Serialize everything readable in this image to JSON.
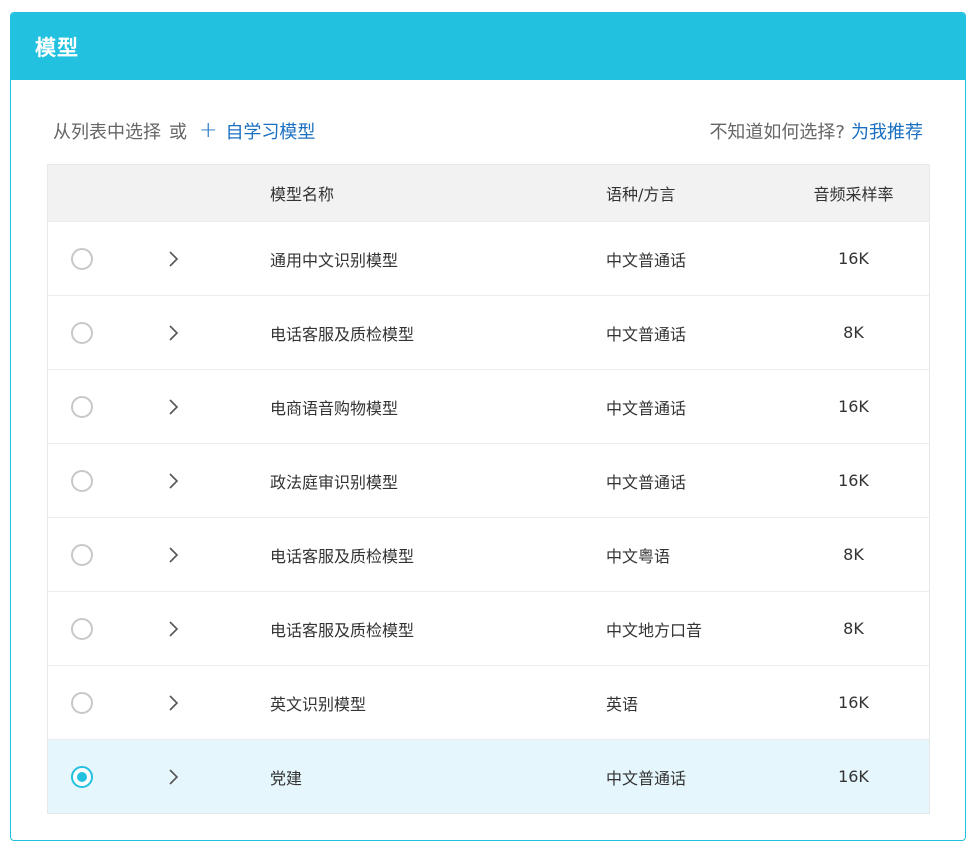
{
  "panel": {
    "title": "模型"
  },
  "toolbar": {
    "select_label": "从列表中选择",
    "or_label": "或",
    "plus_icon": "+",
    "self_learn_label": "自学习模型",
    "question_label": "不知道如何选择?",
    "recommend_label": "为我推荐"
  },
  "table": {
    "headers": {
      "name": "模型名称",
      "lang": "语种/方言",
      "rate": "音频采样率"
    },
    "rows": [
      {
        "name": "通用中文识别模型",
        "lang": "中文普通话",
        "rate": "16K",
        "selected": false
      },
      {
        "name": "电话客服及质检模型",
        "lang": "中文普通话",
        "rate": "8K",
        "selected": false
      },
      {
        "name": "电商语音购物模型",
        "lang": "中文普通话",
        "rate": "16K",
        "selected": false
      },
      {
        "name": "政法庭审识别模型",
        "lang": "中文普通话",
        "rate": "16K",
        "selected": false
      },
      {
        "name": "电话客服及质检模型",
        "lang": "中文粤语",
        "rate": "8K",
        "selected": false
      },
      {
        "name": "电话客服及质检模型",
        "lang": "中文地方口音",
        "rate": "8K",
        "selected": false
      },
      {
        "name": "英文识别模型",
        "lang": "英语",
        "rate": "16K",
        "selected": false
      },
      {
        "name": "党建",
        "lang": "中文普通话",
        "rate": "16K",
        "selected": true
      }
    ]
  },
  "colors": {
    "accent": "#21c1df",
    "link": "#1a6fc0",
    "selected_row": "#e5f6fc"
  }
}
